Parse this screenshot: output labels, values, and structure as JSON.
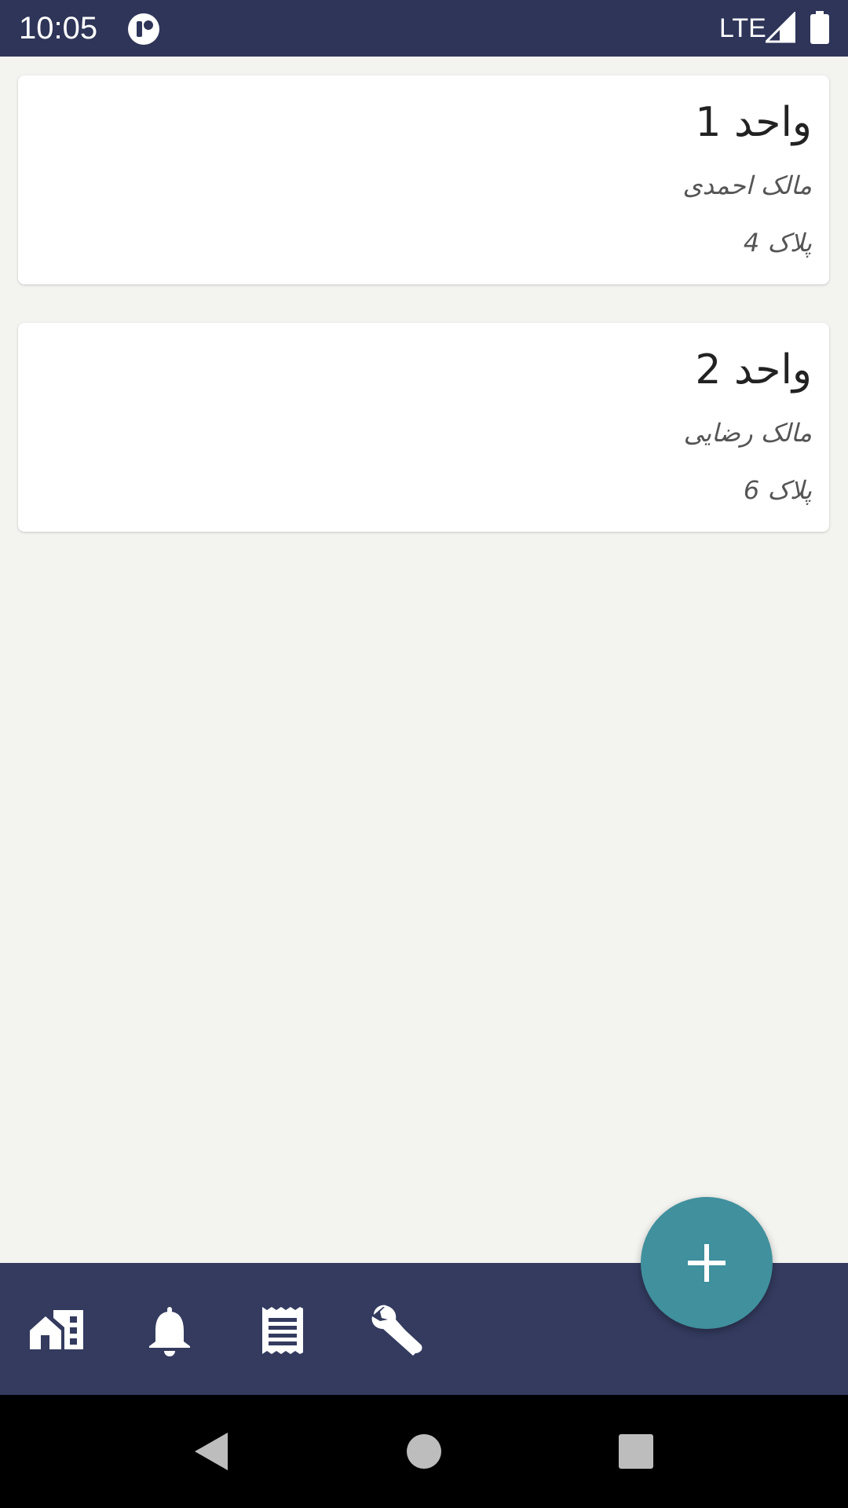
{
  "status_bar": {
    "time": "10:05",
    "network": "LTE",
    "app_icon": "app-notification-icon",
    "signal_icon": "signal-icon",
    "battery_icon": "battery-icon"
  },
  "units": [
    {
      "name": "واحد 1",
      "owner": "مالک احمدی",
      "plate": "پلاک 4"
    },
    {
      "name": "واحد 2",
      "owner": "مالک رضایی",
      "plate": "پلاک 6"
    }
  ],
  "fab": {
    "icon": "plus-icon"
  },
  "bottom_nav": [
    {
      "icon": "buildings-icon"
    },
    {
      "icon": "bell-icon"
    },
    {
      "icon": "receipt-icon"
    },
    {
      "icon": "wrench-icon"
    }
  ],
  "system_nav": [
    {
      "icon": "back-icon"
    },
    {
      "icon": "home-icon"
    },
    {
      "icon": "recents-icon"
    }
  ],
  "colors": {
    "status_bar": "#2e3558",
    "bottom_bar": "#343b5f",
    "background": "#f3f3f0",
    "card": "#ffffff",
    "fab": "#40909d",
    "system_nav": "#000000"
  }
}
